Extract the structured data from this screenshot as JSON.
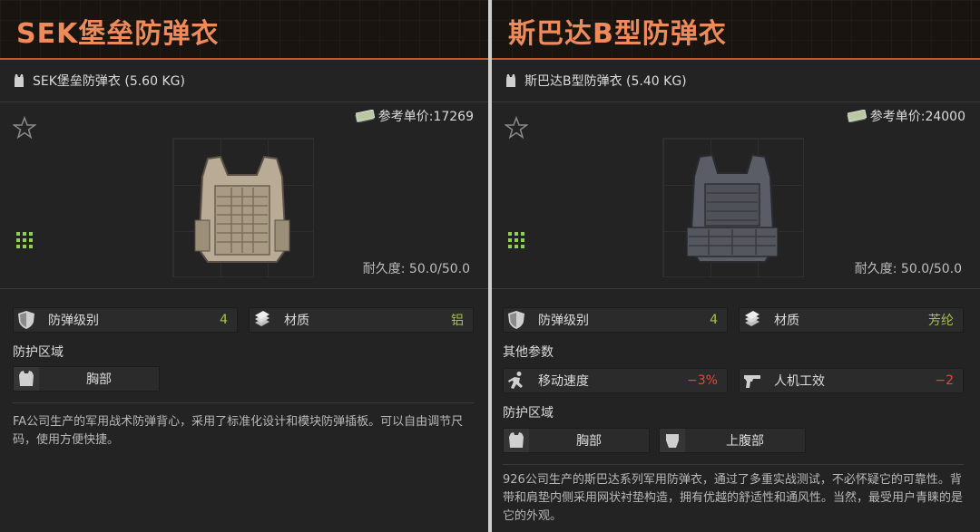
{
  "left": {
    "title": "SEK堡垒防弹衣",
    "weight_line": "SEK堡垒防弹衣 (5.60 KG)",
    "price": "参考单价:17269",
    "durability": "耐久度: 50.0/50.0",
    "armor_level_label": "防弹级别",
    "armor_level_value": "4",
    "material_label": "材质",
    "material_value": "铝",
    "protect_zone_label": "防护区域",
    "zones": [
      "胸部"
    ],
    "description": "FA公司生产的军用战术防弹背心，采用了标准化设计和模块防弹插板。可以自由调节尺码，使用方便快捷。"
  },
  "right": {
    "title": "斯巴达B型防弹衣",
    "weight_line": "斯巴达B型防弹衣 (5.40 KG)",
    "price": "参考单价:24000",
    "durability": "耐久度: 50.0/50.0",
    "armor_level_label": "防弹级别",
    "armor_level_value": "4",
    "material_label": "材质",
    "material_value": "芳纶",
    "other_params_label": "其他参数",
    "move_speed_label": "移动速度",
    "move_speed_value": "−3%",
    "ergonomics_label": "人机工效",
    "ergonomics_value": "−2",
    "protect_zone_label": "防护区域",
    "zones": [
      "胸部",
      "上腹部"
    ],
    "description": "926公司生产的斯巴达系列军用防弹衣，通过了多重实战测试，不必怀疑它的可靠性。背带和肩垫内侧采用网状衬垫构造，拥有优越的舒适性和通风性。当然，最受用户青睐的是它的外观。"
  },
  "colors": {
    "title": "#ef8a5a",
    "accent_line": "#c85a2a",
    "value_green": "#a7c04a",
    "value_red": "#e24a3b"
  }
}
